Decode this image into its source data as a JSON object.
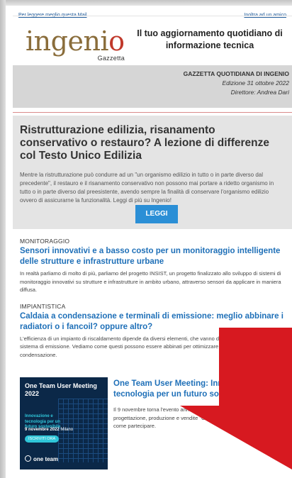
{
  "toplinks": {
    "read_online": "Per leggere meglio questa Mail",
    "forward": "Inoltra ad un amico"
  },
  "logo": {
    "word": "ingenio",
    "sub": "Gazzetta"
  },
  "header": {
    "tagline": "Il tuo aggiornamento quotidiano di informazione tecnica"
  },
  "edition": {
    "name": "GAZZETTA QUOTIDIANA DI INGENIO",
    "issue": "Edizione 31 ottobre 2022",
    "director": "Direttore: Andrea Dari"
  },
  "feature": {
    "title": "Ristrutturazione edilizia, risanamento conservativo o restauro? A lezione di differenze col Testo Unico Edilizia",
    "body": "Mentre la ristrutturazione può condurre ad un \"un organismo edilizio in tutto o in parte diverso dal precedente\", il restauro e il risanamento conservativo non possono mai portare a ridetto organismo in tutto o in parte diverso dal preesistente, avendo sempre la finalità di conservare l'organismo edilizio ovvero di assicurarne la funzionalità. Leggi di più su Ingenio!",
    "button": "LEGGI"
  },
  "articles": [
    {
      "category": "MONITORAGGIO",
      "title": "Sensori innovativi e a basso costo per un monitoraggio intelligente delle strutture e infrastrutture urbane",
      "body": "In realtà parliamo di molto di più, parliamo del progetto INSIST, un progetto finalizzato allo sviluppo di sistemi di monitoraggio innovativi su strutture e infrastrutture in ambito urbano, attraverso sensori da applicare in maniera diffusa."
    },
    {
      "category": "IMPIANTISTICA",
      "title": "Caldaia a condensazione e terminali di emissione: meglio abbinare i radiatori o i fancoil? oppure altro?",
      "body": "L'efficienza di un impianto di riscaldamento dipende da diversi elementi, che vanno dal sistema di generazione al sistema di emissione. Vediamo come questi possono essere abbinati per ottimizzare i vantaggi legati alle caldaie a condensazione."
    }
  ],
  "promo": {
    "image_title": "One Team User Meeting 2022",
    "image_sub": "Innovazione e tecnologia per un futuro sostenibile",
    "image_date": "9 novembre 2022",
    "image_city": "Milano",
    "image_cta": "ISCRIVITI ORA",
    "image_brand": "one team",
    "title": "One Team User Meeting: Innovazione e tecnologia per un futuro sostenibile",
    "body": "Il 9 novembre torna l'evento annuale dedicato a professionisti della progettazione, produzione e vendite \"One Team User Meeting\". Scopri come partecipare."
  },
  "colors": {
    "link_blue": "#1f70b8",
    "button_blue": "#2b8fd6",
    "arrow_red": "#d71920"
  }
}
